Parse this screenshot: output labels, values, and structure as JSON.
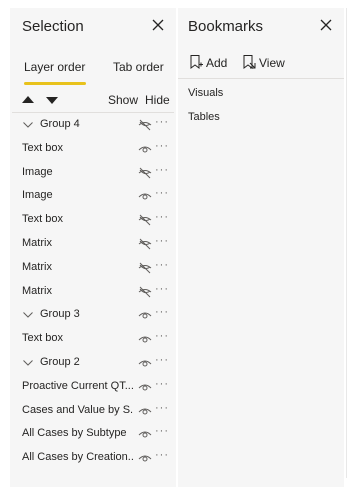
{
  "selection": {
    "title": "Selection",
    "tabs": [
      {
        "label": "Layer order",
        "active": true
      },
      {
        "label": "Tab order",
        "active": false
      }
    ],
    "show_label": "Show",
    "hide_label": "Hide",
    "accent_color": "#e8c21b",
    "layers": [
      {
        "label": "Group 4",
        "group": true,
        "visible": false
      },
      {
        "label": "Text box",
        "group": false,
        "visible": true
      },
      {
        "label": "Image",
        "group": false,
        "visible": false
      },
      {
        "label": "Image",
        "group": false,
        "visible": true
      },
      {
        "label": "Text box",
        "group": false,
        "visible": false
      },
      {
        "label": "Matrix",
        "group": false,
        "visible": false
      },
      {
        "label": "Matrix",
        "group": false,
        "visible": false
      },
      {
        "label": "Matrix",
        "group": false,
        "visible": false
      },
      {
        "label": "Group 3",
        "group": true,
        "visible": true
      },
      {
        "label": "Text box",
        "group": false,
        "visible": true
      },
      {
        "label": "Group 2",
        "group": true,
        "visible": true
      },
      {
        "label": "Proactive Current QT...",
        "group": false,
        "visible": true
      },
      {
        "label": "Cases and Value by S...",
        "group": false,
        "visible": true
      },
      {
        "label": "All Cases by Subtype",
        "group": false,
        "visible": true
      },
      {
        "label": "All Cases by Creation...",
        "group": false,
        "visible": true
      }
    ]
  },
  "bookmarks": {
    "title": "Bookmarks",
    "add_label": "Add",
    "view_label": "View",
    "items": [
      "Visuals",
      "Tables"
    ]
  }
}
